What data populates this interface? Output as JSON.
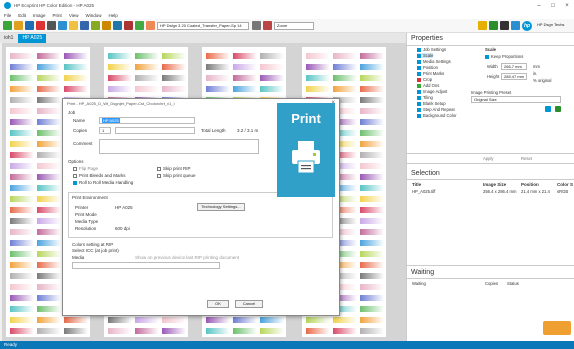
{
  "window": {
    "title": "HP Ecoprint HP Color Edition - HP A025"
  },
  "menu": [
    "File",
    "Edit",
    "Image",
    "Print",
    "View",
    "Window",
    "Help"
  ],
  "toolbar": {
    "profile_select": "HP Dsfgn 3 20 Coated_Transfer_Paper-Sp 14",
    "zoom_select": "Zoom",
    "printer_select": "HP Dsgn Techs"
  },
  "tabs": [
    {
      "label": "ioh1"
    },
    {
      "label": "HP A025"
    }
  ],
  "dialog": {
    "title": "Print - HP_A025_D_Wt_Dsgnjet_Paper-Cst_Cholorchrt_v1_I",
    "section_job": "Job",
    "label_name": "Name",
    "name_value": "HP A025",
    "label_copies": "Copies",
    "copies_value": "1",
    "label_total_length": "Total Length",
    "total_length_value": "3.2 / 3.1 m",
    "label_comment": "Comment",
    "section_options": "Options",
    "opt_mirror": "Flip Page",
    "opt_print_bleed": "Print Bleeds and Marks",
    "opt_roll_to_roll": "Roll to Roll Media Handling",
    "opt_skip_rip": "Skip print RIP",
    "opt_skip_hold": "Skip print queue",
    "section_print_env": "Print Environment",
    "label_printer": "Printer",
    "printer_value": "HP A025",
    "label_print_mode": "Print Mode",
    "label_media_type": "Media Type",
    "label_resolution": "Resolution",
    "resolution_value": "600 dpi",
    "technology_button": "Technology Settings...",
    "section_colors": "Colors setting at RIP",
    "colors_value": "Select ICC (at job print)",
    "label_media": "Media",
    "media_hint": "Show on previous device last RIP printing document",
    "ok_button": "OK",
    "cancel_button": "Cancel",
    "banner_text": "Print"
  },
  "properties": {
    "title": "Properties",
    "items": [
      "Job Settings",
      "Scale",
      "Media Settings",
      "Position",
      "Print Marks",
      "Crop",
      "Add Ons",
      "Image Adjust",
      "Tiling",
      "Blank Setup",
      "Step And Repeat",
      "Background Color"
    ],
    "scale_label": "Scale",
    "keep_proportions": "Keep Proportions",
    "width_label": "Width",
    "width_value": "266.7 mm",
    "height_label": "Height",
    "height_value": "285.47 mm",
    "unit_mm": "mm",
    "unit_in": "in.",
    "unit_pct": "% original",
    "image_preset_label": "Image Printing Preset",
    "image_preset_value": "Original Size",
    "tab_apply": "Apply",
    "tab_reset": "Reset"
  },
  "selection": {
    "title": "Selection",
    "columns": [
      "Title",
      "Image Size",
      "Position",
      "Color S"
    ],
    "row": [
      "HP_A025.tiff",
      "256.4 x 286.4 mm",
      "21.4 mm x 21.4",
      "sRGB"
    ]
  },
  "waiting": {
    "title": "Waiting",
    "columns": [
      "Waiting",
      "Copies",
      "Status"
    ]
  },
  "status": {
    "text": "Ready"
  },
  "colors": {
    "accent": "#0096d6",
    "statusbar": "#0a78b8",
    "banner": "#31a0c8"
  }
}
